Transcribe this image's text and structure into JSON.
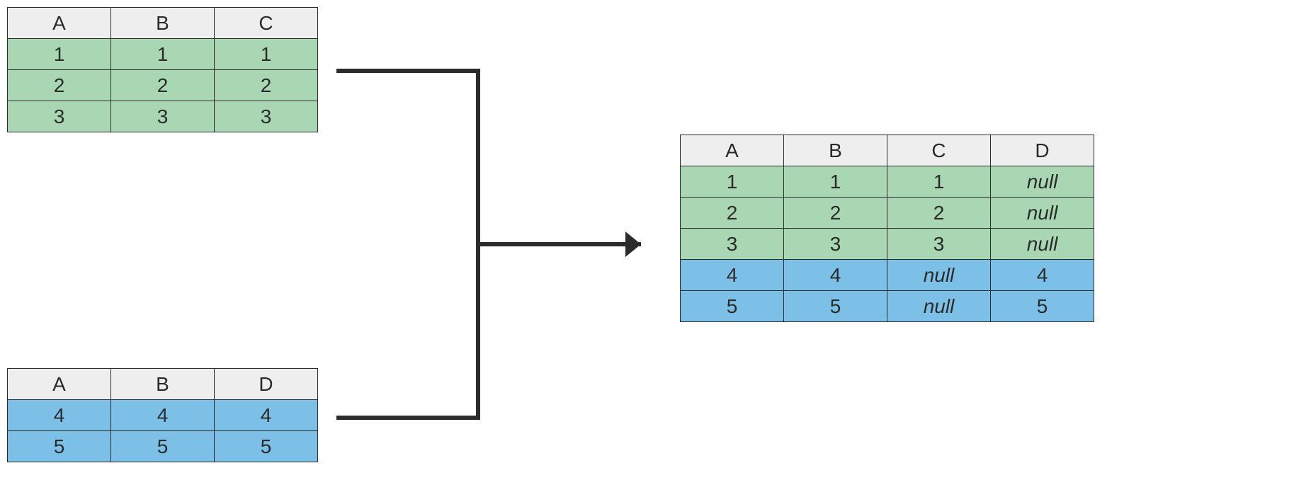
{
  "colors": {
    "header_bg": "#eeeeee",
    "green_row": "#a9d7b4",
    "blue_row": "#7cc0e8",
    "border": "#2b2b2b"
  },
  "table1": {
    "headers": {
      "c0": "A",
      "c1": "B",
      "c2": "C"
    },
    "rows": [
      {
        "c0": "1",
        "c1": "1",
        "c2": "1",
        "row_class": "row-green"
      },
      {
        "c0": "2",
        "c1": "2",
        "c2": "2",
        "row_class": "row-green"
      },
      {
        "c0": "3",
        "c1": "3",
        "c2": "3",
        "row_class": "row-green"
      }
    ]
  },
  "table2": {
    "headers": {
      "c0": "A",
      "c1": "B",
      "c2": "D"
    },
    "rows": [
      {
        "c0": "4",
        "c1": "4",
        "c2": "4",
        "row_class": "row-blue"
      },
      {
        "c0": "5",
        "c1": "5",
        "c2": "5",
        "row_class": "row-blue"
      }
    ]
  },
  "table3": {
    "headers": {
      "c0": "A",
      "c1": "B",
      "c2": "C",
      "c3": "D"
    },
    "rows": [
      {
        "c0": "1",
        "c1": "1",
        "c2": "1",
        "c3": "null",
        "row_class": "row-green",
        "null_cols": [
          "c3"
        ]
      },
      {
        "c0": "2",
        "c1": "2",
        "c2": "2",
        "c3": "null",
        "row_class": "row-green",
        "null_cols": [
          "c3"
        ]
      },
      {
        "c0": "3",
        "c1": "3",
        "c2": "3",
        "c3": "null",
        "row_class": "row-green",
        "null_cols": [
          "c3"
        ]
      },
      {
        "c0": "4",
        "c1": "4",
        "c2": "null",
        "c3": "4",
        "row_class": "row-blue",
        "null_cols": [
          "c2"
        ]
      },
      {
        "c0": "5",
        "c1": "5",
        "c2": "null",
        "c3": "5",
        "row_class": "row-blue",
        "null_cols": [
          "c2"
        ]
      }
    ]
  },
  "chart_data": {
    "type": "table",
    "description": "Diagram showing concatenation/union of two dataframes with differing columns, producing nulls for missing columns.",
    "inputs": [
      {
        "columns": [
          "A",
          "B",
          "C"
        ],
        "rows": [
          [
            1,
            1,
            1
          ],
          [
            2,
            2,
            2
          ],
          [
            3,
            3,
            3
          ]
        ]
      },
      {
        "columns": [
          "A",
          "B",
          "D"
        ],
        "rows": [
          [
            4,
            4,
            4
          ],
          [
            5,
            5,
            5
          ]
        ]
      }
    ],
    "output": {
      "columns": [
        "A",
        "B",
        "C",
        "D"
      ],
      "rows": [
        [
          1,
          1,
          1,
          null
        ],
        [
          2,
          2,
          2,
          null
        ],
        [
          3,
          3,
          3,
          null
        ],
        [
          4,
          4,
          null,
          4
        ],
        [
          5,
          5,
          null,
          5
        ]
      ]
    }
  }
}
